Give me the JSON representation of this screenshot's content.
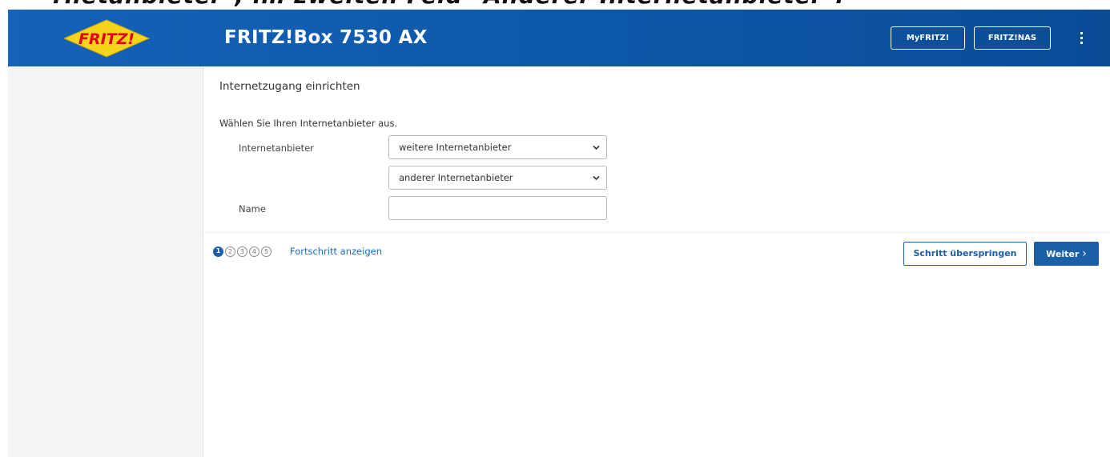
{
  "caption": "rnetanbieter\", im zweiten Feld \"Anderer Internetanbieter\".",
  "header": {
    "logo_text": "FRITZ!",
    "title": "FRITZ!Box 7530 AX",
    "buttons": {
      "myfritz": "MyFRITZ!",
      "nas": "FRITZ!NAS"
    },
    "menu_icon": "kebab-menu-icon",
    "brand_color": "#0d57a8"
  },
  "main": {
    "title": "Internetzugang einrichten",
    "intro": "Wählen Sie Ihren Internetanbieter aus.",
    "form": {
      "provider_label": "Internetanbieter",
      "provider_select_1": "weitere Internetanbieter",
      "provider_select_2": "anderer Internetanbieter",
      "name_label": "Name",
      "name_value": ""
    }
  },
  "footer": {
    "steps": [
      "1",
      "2",
      "3",
      "4",
      "5"
    ],
    "current_step": 1,
    "progress_link": "Fortschritt anzeigen",
    "skip_button": "Schritt überspringen",
    "next_button": "Weiter",
    "accent_color": "#1a5fa8"
  }
}
